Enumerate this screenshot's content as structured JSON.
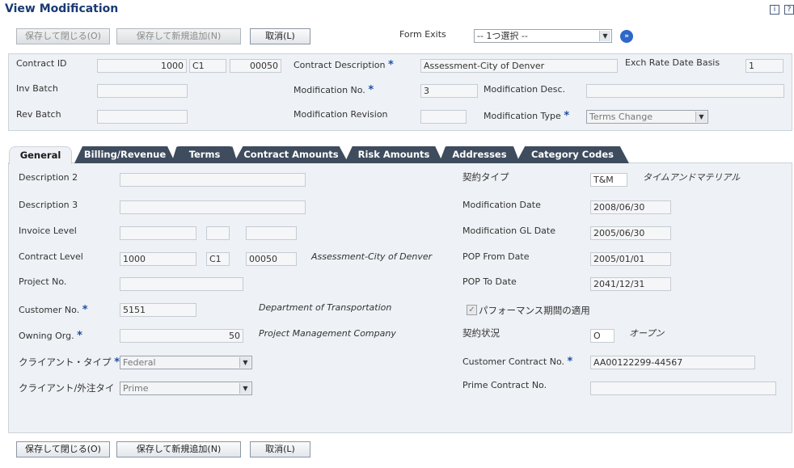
{
  "window": {
    "title": "View Modification",
    "help_icon": "i",
    "question_icon": "?"
  },
  "toolbar": {
    "save_close": "保存して閉じる(O)",
    "save_add": "保存して新規追加(N)",
    "cancel": "取消(L)",
    "form_exits_label": "Form Exits",
    "form_exits_value": "-- 1つ選択 --"
  },
  "header": {
    "contract_id_label": "Contract ID",
    "contract_id": "1000",
    "contract_company": "C1",
    "contract_suffix": "00050",
    "contract_desc_label": "Contract Description",
    "contract_desc": "Assessment-City of Denver",
    "exch_rate_label": "Exch Rate Date Basis",
    "exch_rate": "1",
    "inv_batch_label": "Inv Batch",
    "inv_batch": "",
    "mod_no_label": "Modification No.",
    "mod_no": "3",
    "mod_desc_label": "Modification Desc.",
    "mod_desc": "",
    "rev_batch_label": "Rev Batch",
    "rev_batch": "",
    "mod_rev_label": "Modification Revision",
    "mod_rev": "",
    "mod_type_label": "Modification Type",
    "mod_type": "Terms Change"
  },
  "tabs": [
    "General",
    "Billing/Revenue",
    "Terms",
    "Contract Amounts",
    "Risk Amounts",
    "Addresses",
    "Category Codes"
  ],
  "general": {
    "desc2_label": "Description 2",
    "desc2": "",
    "desc3_label": "Description 3",
    "desc3": "",
    "invoice_level_label": "Invoice Level",
    "invoice_level_1": "",
    "invoice_level_2": "",
    "invoice_level_3": "",
    "contract_level_label": "Contract Level",
    "contract_level_1": "1000",
    "contract_level_2": "C1",
    "contract_level_3": "00050",
    "contract_level_desc": "Assessment-City of Denver",
    "project_no_label": "Project No.",
    "project_no": "",
    "customer_no_label": "Customer No.",
    "customer_no": "5151",
    "customer_desc": "Department of Transportation",
    "owning_org_label": "Owning Org.",
    "owning_org": "50",
    "owning_org_desc": "Project Management Company",
    "client_type_label": "クライアント・タイプ",
    "client_type": "Federal",
    "client_sub_label": "クライアント/外注タイプ",
    "client_sub": "Prime",
    "contract_type_label": "契約タイプ",
    "contract_type": "T&M",
    "contract_type_desc": "タイムアンドマテリアル",
    "mod_date_label": "Modification Date",
    "mod_date": "2008/06/30",
    "mod_gl_date_label": "Modification GL Date",
    "mod_gl_date": "2005/06/30",
    "pop_from_label": "POP From Date",
    "pop_from": "2005/01/01",
    "pop_to_label": "POP To Date",
    "pop_to": "2041/12/31",
    "pop_apply_label": "パフォーマンス期間の適用",
    "pop_apply_checked": true,
    "contract_status_label": "契約状況",
    "contract_status": "O",
    "contract_status_desc": "オープン",
    "cust_contract_label": "Customer Contract No.",
    "cust_contract": "AA00122299-44567",
    "prime_contract_label": "Prime Contract No.",
    "prime_contract": ""
  },
  "footer": {
    "save_close": "保存して閉じる(O)",
    "save_add": "保存して新規追加(N)",
    "cancel": "取消(L)"
  },
  "icons": {
    "go": "go-arrow-icon",
    "checkbox": "checkbox-checked-icon",
    "dropdown": "chevron-down-icon"
  },
  "colors": {
    "title": "#1a3a73",
    "tab_bg": "#3e4c5e",
    "panel_bg": "#eef1f5",
    "required_star": "#1e4fa6"
  }
}
